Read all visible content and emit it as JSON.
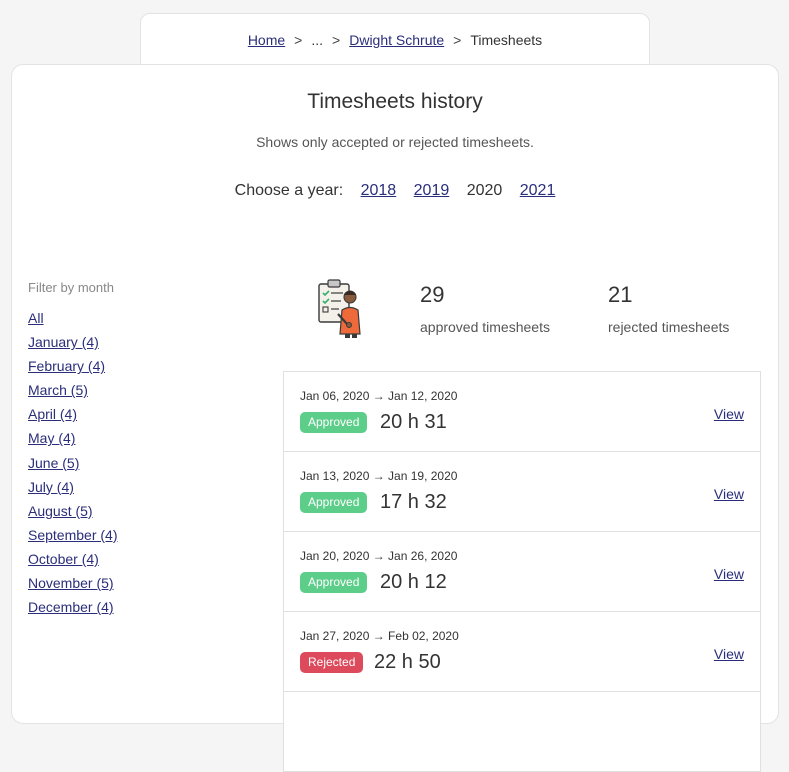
{
  "breadcrumb": {
    "home": "Home",
    "separator": ">",
    "ellipsis": "...",
    "person": "Dwight Schrute",
    "current": "Timesheets"
  },
  "header": {
    "title": "Timesheets history",
    "subtitle": "Shows only accepted or rejected timesheets."
  },
  "year_picker": {
    "label": "Choose a year:",
    "years": [
      {
        "label": "2018",
        "current": false
      },
      {
        "label": "2019",
        "current": false
      },
      {
        "label": "2020",
        "current": true
      },
      {
        "label": "2021",
        "current": false
      }
    ]
  },
  "filter": {
    "label": "Filter by month",
    "months": [
      "All",
      "January (4)",
      "February (4)",
      "March (5)",
      "April (4)",
      "May (4)",
      "June (5)",
      "July (4)",
      "August (5)",
      "September (4)",
      "October (4)",
      "November (5)",
      "December (4)"
    ]
  },
  "stats": {
    "approved": {
      "value": "29",
      "label": "approved timesheets"
    },
    "rejected": {
      "value": "21",
      "label": "rejected timesheets"
    }
  },
  "timesheets": [
    {
      "range": "Jan 06, 2020 → Jan 12, 2020",
      "status": "Approved",
      "hours": "20 h 31",
      "view": "View"
    },
    {
      "range": "Jan 13, 2020 → Jan 19, 2020",
      "status": "Approved",
      "hours": "17 h 32",
      "view": "View"
    },
    {
      "range": "Jan 20, 2020 → Jan 26, 2020",
      "status": "Approved",
      "hours": "20 h 12",
      "view": "View"
    },
    {
      "range": "Jan 27, 2020 → Feb 02, 2020",
      "status": "Rejected",
      "hours": "22 h 50",
      "view": "View"
    }
  ],
  "colors": {
    "approved": "#5dcd8a",
    "rejected": "#dc4a5b",
    "link": "#2a2e7a"
  },
  "icons": {
    "illustration": "clipboard-person-icon"
  }
}
